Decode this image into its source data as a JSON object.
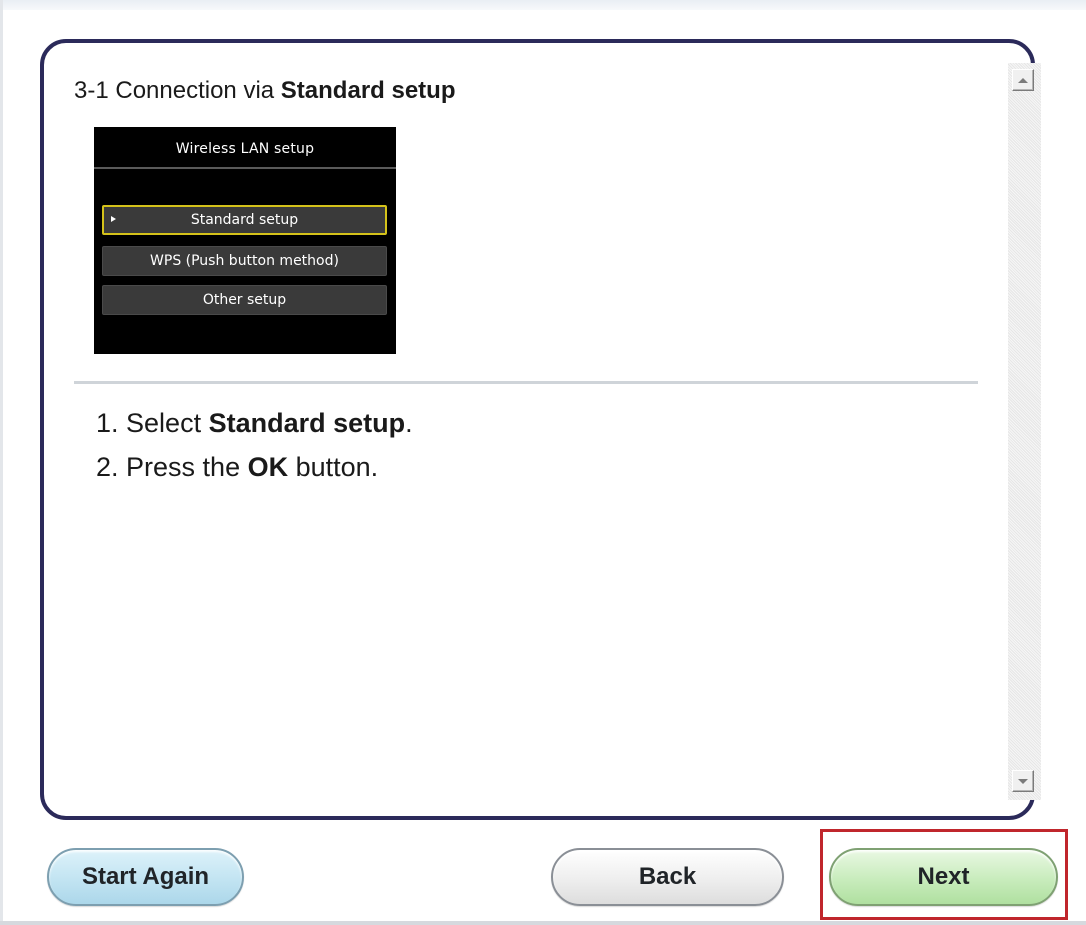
{
  "heading": {
    "prefix": "3-1 Connection via ",
    "emphasis": "Standard setup"
  },
  "lcd": {
    "title": "Wireless LAN setup",
    "menu_items": [
      {
        "label": "Standard setup",
        "selected": true
      },
      {
        "label": "WPS (Push button method)",
        "selected": false
      },
      {
        "label": "Other setup",
        "selected": false
      }
    ]
  },
  "steps": [
    {
      "number": "1. ",
      "pre": "Select ",
      "bold": "Standard setup",
      "post": "."
    },
    {
      "number": "2. ",
      "pre": "Press the ",
      "bold": "OK",
      "post": " button."
    }
  ],
  "buttons": {
    "start_again": "Start Again",
    "back": "Back",
    "next": "Next"
  },
  "icons": {
    "scroll_up": "scroll-up-arrow-icon",
    "scroll_down": "scroll-down-arrow-icon",
    "lcd_cursor": "menu-cursor-icon"
  },
  "colors": {
    "panel_border": "#2b2a5a",
    "start_button": "#c2e4f2",
    "back_button": "#eeeeee",
    "next_button": "#c8ecbc",
    "highlight": "#c0262c",
    "lcd_selection": "#d4c21a"
  }
}
